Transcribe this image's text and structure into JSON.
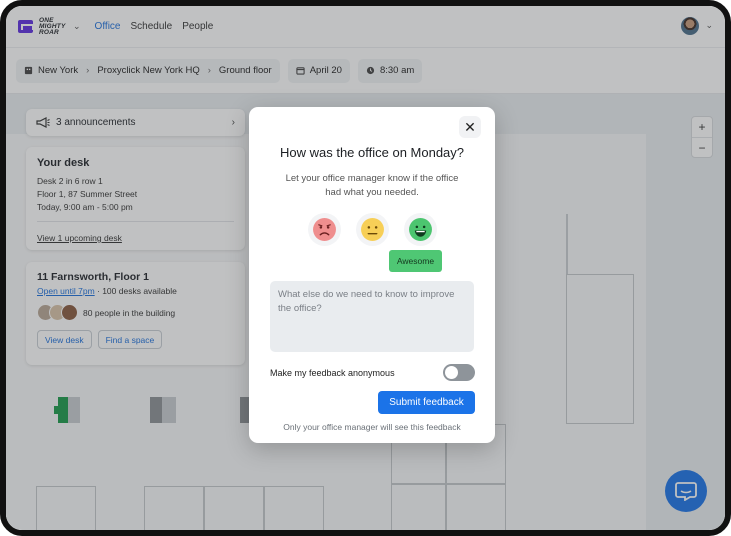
{
  "brand": {
    "logo_text": "ONE MIGHTY ROAR",
    "accent": "#1b73e8"
  },
  "nav": {
    "items": [
      "Office",
      "Schedule",
      "People"
    ],
    "active": "Office"
  },
  "filters": {
    "location": [
      "New York",
      "Proxyclick New York HQ",
      "Ground floor"
    ],
    "date": "April 20",
    "time": "8:30 am"
  },
  "announcements": {
    "label": "3  announcements"
  },
  "your_desk": {
    "title": "Your desk",
    "lines": [
      "Desk 2 in 6 row 1",
      "Floor 1, 87 Summer Street",
      "Today, 9:00 am - 5:00 pm"
    ],
    "link": "View 1 upcoming desk"
  },
  "building": {
    "title": "11 Farnsworth, Floor 1",
    "open_until": "Open until 7pm",
    "availability": " · 100 desks available",
    "people": "80 people in the building",
    "buttons": [
      "View desk",
      "Find a space"
    ]
  },
  "zoom": {
    "in": "+",
    "out": "−"
  },
  "feedback_modal": {
    "title": "How was the office on Monday?",
    "subtitle": "Let your office manager know if the office had what you needed.",
    "ratings": [
      "sad",
      "neutral",
      "awesome"
    ],
    "selected_tooltip": "Awesome",
    "textarea_placeholder": "What else do we need to know to improve the office?",
    "anonymous_label": "Make my feedback anonymous",
    "anonymous_on": false,
    "submit_label": "Submit feedback",
    "note": "Only your office manager will see this feedback"
  }
}
